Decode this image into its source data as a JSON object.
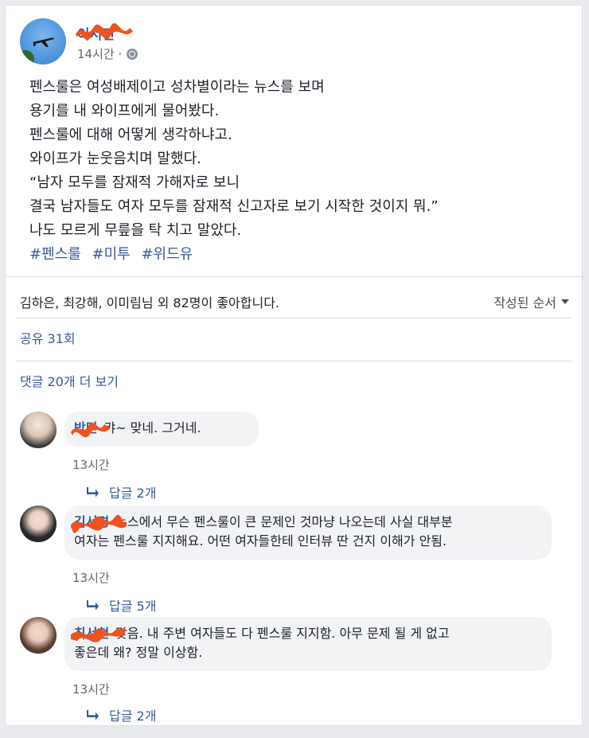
{
  "post": {
    "author": "이서진",
    "time": "14시간 ·",
    "privacy_icon": "globe-icon",
    "lines": [
      "펜스룰은 여성배제이고 성차별이라는 뉴스를 보며",
      "용기를 내 와이프에게 물어봤다.",
      "펜스룰에 대해 어떻게 생각하냐고.",
      "와이프가 눈웃음치며 말했다.",
      "“남자 모두를 잠재적 가해자로 보니",
      "결국 남자들도 여자 모두를 잠재적 신고자로 보기 시작한 것이지 뭐.”",
      "나도 모르게 무릎을 탁 치고 말았다."
    ],
    "hashtags": [
      "#펜스룰",
      "#미투",
      "#위드유"
    ]
  },
  "reactions": {
    "likes_text": "김하은, 최강해, 이미림님 외 82명이 좋아합니다.",
    "sort_label": "작성된 순서"
  },
  "shares_text": "공유 31회",
  "more_comments_text": "댓글 20개 더 보기",
  "comments": [
    {
      "name": "박민",
      "text_lines": [
        "캬~ 맞네. 그거네."
      ],
      "time": "13시간",
      "replies": "답글 2개"
    },
    {
      "name": "김서경",
      "text_lines": [
        "뉴스에서 무슨 펜스룰이 큰 문제인 것마냥 나오는데 사실 대부분",
        "여자는 펜스룰 지지해요. 어떤 여자들한테 인터뷰 딴 건지 이해가 안됨."
      ],
      "time": "13시간",
      "replies": "답글 5개"
    },
    {
      "name": "최서현",
      "text_lines": [
        "맞음. 내 주변 여자들도 다 펜스룰 지지함. 아무 문제 될 게 없고",
        "좋은데 왜? 정말 이상함."
      ],
      "time": "13시간",
      "replies": "답글 2개"
    }
  ],
  "colors": {
    "link": "#385898",
    "bubble": "#f2f3f5",
    "redaction": "#f0521e"
  }
}
